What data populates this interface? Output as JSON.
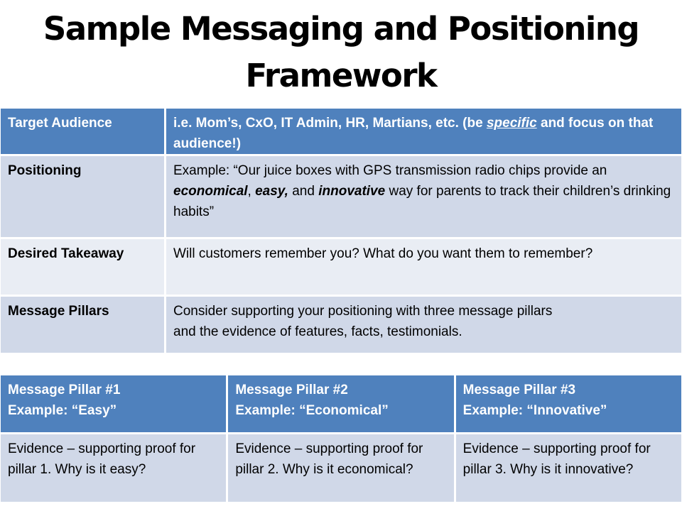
{
  "title": "Sample Messaging and Positioning Framework",
  "framework_table": {
    "target_audience": {
      "label": "Target Audience",
      "text_before": "i.e. Mom’s, CxO, IT Admin, HR, Martians, etc. (be ",
      "emphasis": "specific",
      "text_after": " and focus on that audience!)"
    },
    "positioning": {
      "label": "Positioning",
      "prefix": "Example:  “Our juice boxes with GPS transmission radio chips provide an ",
      "word1": "economical",
      "sep1": ", ",
      "word2": "easy,",
      "sep2": " and ",
      "word3": "innovative",
      "suffix": " way for parents to track their children’s drinking habits”"
    },
    "desired_takeaway": {
      "label": "Desired Takeaway",
      "text": "Will customers remember you? What do you want them to remember?"
    },
    "message_pillars": {
      "label": "Message Pillars",
      "line1": "Consider supporting your positioning with three message pillars",
      "line2": "and the evidence of features, facts, testimonials."
    }
  },
  "pillars_table": {
    "pillars": [
      {
        "title": "Message Pillar #1",
        "example": "Example: “Easy”",
        "evidence": "Evidence – supporting proof for pillar 1.  Why is it easy?"
      },
      {
        "title": "Message Pillar #2",
        "example": "Example:  “Economical”",
        "evidence": "Evidence – supporting proof for pillar 2. Why is it economical?"
      },
      {
        "title": "Message Pillar #3",
        "example": "Example:  “Innovative”",
        "evidence": "Evidence – supporting proof for pillar 3. Why is it innovative?"
      }
    ]
  },
  "colors": {
    "header_bg": "#4f81bd",
    "row_dark": "#d0d8e8",
    "row_light": "#e9edf4"
  }
}
